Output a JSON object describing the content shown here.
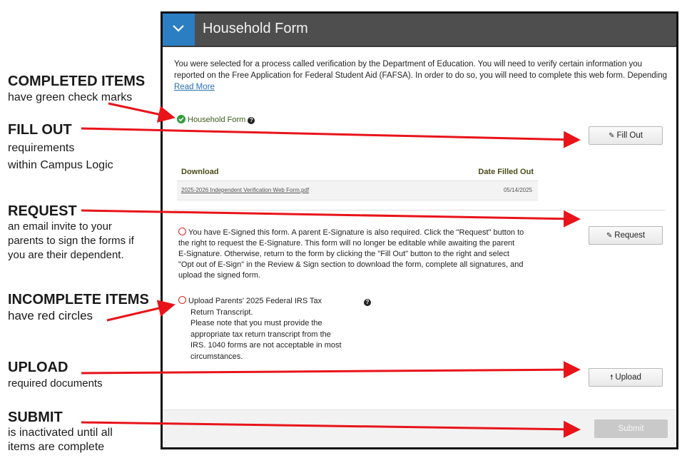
{
  "annotations": [
    {
      "key": "completed",
      "title": "COMPLETED ITEMS",
      "lines": [
        "have green check marks"
      ]
    },
    {
      "key": "fill-out",
      "title": "FILL OUT",
      "lines": [
        "requirements",
        "within Campus Logic"
      ]
    },
    {
      "key": "request",
      "title": "REQUEST",
      "lines": [
        "an email invite to your",
        "parents to sign the forms if",
        "you are their dependent."
      ]
    },
    {
      "key": "incomplete",
      "title": "INCOMPLETE ITEMS",
      "lines": [
        "have red circles"
      ]
    },
    {
      "key": "upload",
      "title": "UPLOAD",
      "lines": [
        "required documents"
      ]
    },
    {
      "key": "submit",
      "title": "SUBMIT",
      "lines": [
        "is inactivated until all",
        "items are complete"
      ]
    }
  ],
  "panel": {
    "title": "Household Form",
    "collapse_icon": "chevron-down-icon",
    "intro_lines": [
      "You were selected for a process called verification by the Department of Education. You will need to verify certain information you",
      "reported on the Free Application for Federal Student Aid (FAFSA). In order to do so, you will need to complete this web form. Depending"
    ],
    "read_more": "Read More",
    "completed_item": {
      "label": "Household Form",
      "status_icon": "check-circle-icon",
      "help_icon": "help-icon"
    },
    "buttons": {
      "fill_out": "Fill Out",
      "request": "Request",
      "upload": "Upload",
      "submit": "Submit"
    },
    "download_table": {
      "headers": [
        "Download",
        "Date Filled Out"
      ],
      "rows": [
        {
          "file": "2025-2026 Independent Verification Web Form.pdf",
          "date": "05/14/2025"
        }
      ]
    },
    "esign_item": {
      "lines": [
        "You have E-Signed this form. A parent E-Signature is also required. Click the \"Request\" button to",
        "the right to request the E-Signature. This form will no longer be editable while awaiting the parent",
        "E-Signature. Otherwise, return to the form by clicking the \"Fill Out\" button to the right and select",
        "\"Opt out of E-Sign\" in the Review & Sign section to download the form, complete all signatures, and",
        "upload the signed form."
      ]
    },
    "upload_item": {
      "lines": [
        "Upload Parents' 2025 Federal IRS Tax",
        "Return Transcript.",
        "Please note that you must provide the",
        "appropriate tax return transcript from the",
        "IRS. 1040 forms are not acceptable in most",
        "circumstances."
      ]
    }
  },
  "colors": {
    "header_bg": "#4e4e4e",
    "collapse_bg": "#2b7ec2",
    "complete": "#2e9c3c",
    "incomplete": "#e01d1d",
    "arrow": "#e8141a"
  }
}
